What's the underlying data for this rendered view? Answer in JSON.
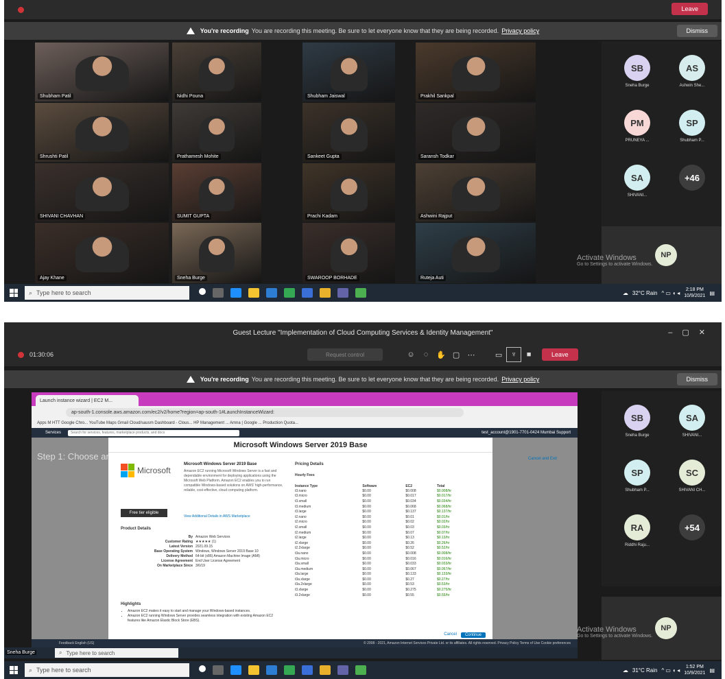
{
  "rec_banner": {
    "bold": "You're recording",
    "text": "You are recording this meeting. Be sure to let everyone know that they are being recorded.",
    "link": "Privacy policy",
    "dismiss": "Dismiss"
  },
  "shot1": {
    "tiles": [
      {
        "name": "Shubham Patil"
      },
      {
        "name": "Nidhi Pouna"
      },
      {
        "name": "Shubham Jaiswal"
      },
      {
        "name": "Prakhil Sankpal"
      },
      {
        "name": "Shrushti Patil"
      },
      {
        "name": "Prathamesh Mohite"
      },
      {
        "name": "Sankeet Gupta"
      },
      {
        "name": "Saransh Todkar"
      },
      {
        "name": "SHIVANI CHAVHAN"
      },
      {
        "name": "SUMIT GUPTA"
      },
      {
        "name": "Prachi Kadam"
      },
      {
        "name": "Ashwini Rajput"
      },
      {
        "name": "Ajay Khane"
      },
      {
        "name": "Sneha Burge"
      },
      {
        "name": "SWAROOP BORHADE"
      },
      {
        "name": "Ruteja Auti"
      }
    ],
    "avatars": [
      {
        "initials": "SB",
        "name": "Sneha Burge",
        "color": "#d9d2f0"
      },
      {
        "initials": "AS",
        "name": "Ashwin She...",
        "color": "#d7ecec"
      },
      {
        "initials": "PM",
        "name": "PRUNEYA ...",
        "color": "#f8d7d7"
      },
      {
        "initials": "SP",
        "name": "Shubham P...",
        "color": "#d3eef0"
      },
      {
        "initials": "SA",
        "name": "SHIVANI...",
        "color": "#d3eef0"
      },
      {
        "initials": "+46",
        "name": "",
        "color": "#3d3d3d"
      }
    ],
    "self_initials": "NP",
    "activate_title": "Activate Windows",
    "activate_sub": "Go to Settings to activate Windows.",
    "taskbar": {
      "search_placeholder": "Type here to search",
      "weather": "32°C Rain",
      "time": "2:18 PM",
      "date": "10/9/2021"
    }
  },
  "shot2": {
    "window_title": "Guest Lecture \"Implementation of Cloud Computing Services & Identity Management\"",
    "timer": "01:30:06",
    "request_control": "Request control",
    "leave": "Leave",
    "browser": {
      "tab_title": "Launch instance wizard | EC2 M...",
      "url": "ap-south-1.console.aws.amazon.com/ec2/v2/home?region=ap-south-1#LaunchInstanceWizard:",
      "bookmarks": "Apps   M  HTT  Google Chro...   YouTube   Maps   Gmail   Cloud/sausm   Dashboard - Clous...   HP Management ...   Amna | Google ...   Production Quota...",
      "aws_services": "Services",
      "aws_search": "Search for services, features, marketplace products, and docs",
      "aws_right": "test_account@1901-7701-0424   Mumbai   Support",
      "step": "Step 1: Choose an",
      "modal_title": "Microsoft Windows Server 2019 Base",
      "ms_word": "Microsoft",
      "free_button": "Free tier eligible",
      "product_title": "Microsoft Windows Server 2019 Base",
      "product_desc": "Amazon EC2 running Microsoft Windows Server is a fast and dependable environment for deploying applications using the Microsoft Web Platform. Amazon EC2 enables you to run compatible Windows-based solutions on AWS' high-performance, reliable, cost-effective, cloud computing platform.",
      "more_link": "View Additional Details in AWS Marketplace",
      "details_heading": "Product Details",
      "details": [
        {
          "k": "By",
          "v": "Amazon Web Services"
        },
        {
          "k": "Customer Rating",
          "v": "★★★★★ (1)"
        },
        {
          "k": "Latest Version",
          "v": "2021.09.15"
        },
        {
          "k": "Base Operating System",
          "v": "Windows, Windows Server 2019 Base 10"
        },
        {
          "k": "Delivery Method",
          "v": "64-bit (x86) Amazon Machine Image (AMI)"
        },
        {
          "k": "License Agreement",
          "v": "End User License Agreement"
        },
        {
          "k": "On Marketplace Since",
          "v": "3/6/19"
        }
      ],
      "highlights_heading": "Highlights",
      "highlights": [
        "Amazon EC2 makes it easy to start and manage your Windows-based instances.",
        "Amazon EC2 running Windows Server provides seamless integration with existing Amazon EC2 features like Amazon Elastic Block Store (EBS)."
      ],
      "pricing_heading": "Pricing Details",
      "hourly": "Hourly Fees",
      "pricing_headers": [
        "Instance Type",
        "Software",
        "EC2",
        "Total"
      ],
      "pricing_rows": [
        [
          "t3.nano",
          "$0.00",
          "$0.008",
          "$0.008/hr"
        ],
        [
          "t3.micro",
          "$0.00",
          "$0.017",
          "$0.017/hr"
        ],
        [
          "t3.small",
          "$0.00",
          "$0.034",
          "$0.034/hr"
        ],
        [
          "t3.medium",
          "$0.00",
          "$0.068",
          "$0.068/hr"
        ],
        [
          "t3.large",
          "$0.00",
          "$0.137",
          "$0.137/hr"
        ],
        [
          "t2.nano",
          "$0.00",
          "$0.01",
          "$0.01/hr"
        ],
        [
          "t2.micro",
          "$0.00",
          "$0.02",
          "$0.02/hr"
        ],
        [
          "t2.small",
          "$0.00",
          "$0.03",
          "$0.03/hr"
        ],
        [
          "t2.medium",
          "$0.00",
          "$0.07",
          "$0.07/hr"
        ],
        [
          "t2.large",
          "$0.00",
          "$0.13",
          "$0.13/hr"
        ],
        [
          "t2.xlarge",
          "$0.00",
          "$0.26",
          "$0.26/hr"
        ],
        [
          "t2.2xlarge",
          "$0.00",
          "$0.52",
          "$0.52/hr"
        ],
        [
          "t3a.nano",
          "$0.00",
          "$0.008",
          "$0.008/hr"
        ],
        [
          "t3a.micro",
          "$0.00",
          "$0.016",
          "$0.016/hr"
        ],
        [
          "t3a.small",
          "$0.00",
          "$0.033",
          "$0.033/hr"
        ],
        [
          "t3a.medium",
          "$0.00",
          "$0.067",
          "$0.067/hr"
        ],
        [
          "t3a.large",
          "$0.00",
          "$0.133",
          "$0.133/hr"
        ],
        [
          "t3a.xlarge",
          "$0.00",
          "$0.27",
          "$0.27/hr"
        ],
        [
          "t3a.2xlarge",
          "$0.00",
          "$0.53",
          "$0.53/hr"
        ],
        [
          "t3.xlarge",
          "$0.00",
          "$0.275",
          "$0.275/hr"
        ],
        [
          "t3.2xlarge",
          "$0.00",
          "$0.55",
          "$0.55/hr"
        ]
      ],
      "cancel": "Cancel",
      "continue": "Continue",
      "cancel_exit": "Cancel and Exit",
      "status_left": "Feedback   English (US)",
      "status_right": "© 2008 - 2021, Amazon Internet Services Private Ltd. or its affiliates. All rights reserved.   Privacy Policy   Terms of Use   Cookie preferences"
    },
    "avatars": [
      {
        "initials": "SB",
        "name": "Sneha Burge",
        "color": "#d9d2f0"
      },
      {
        "initials": "SA",
        "name": "SHIVANI...",
        "color": "#d3eef0"
      },
      {
        "initials": "SP",
        "name": "Shubham P...",
        "color": "#d3eef0"
      },
      {
        "initials": "SC",
        "name": "SHIVANI CH...",
        "color": "#e4ecd8"
      },
      {
        "initials": "RA",
        "name": "Riddhi Raju...",
        "color": "#e4ecd8"
      },
      {
        "initials": "+54",
        "name": "",
        "color": "#3d3d3d"
      }
    ],
    "self_initials": "NP",
    "presenter_badge": "Sneha Burge",
    "inner_search": "Type here to search",
    "taskbar": {
      "search_placeholder": "Type here to search",
      "weather": "31°C Rain",
      "time": "1:52 PM",
      "date": "10/9/2021"
    }
  }
}
